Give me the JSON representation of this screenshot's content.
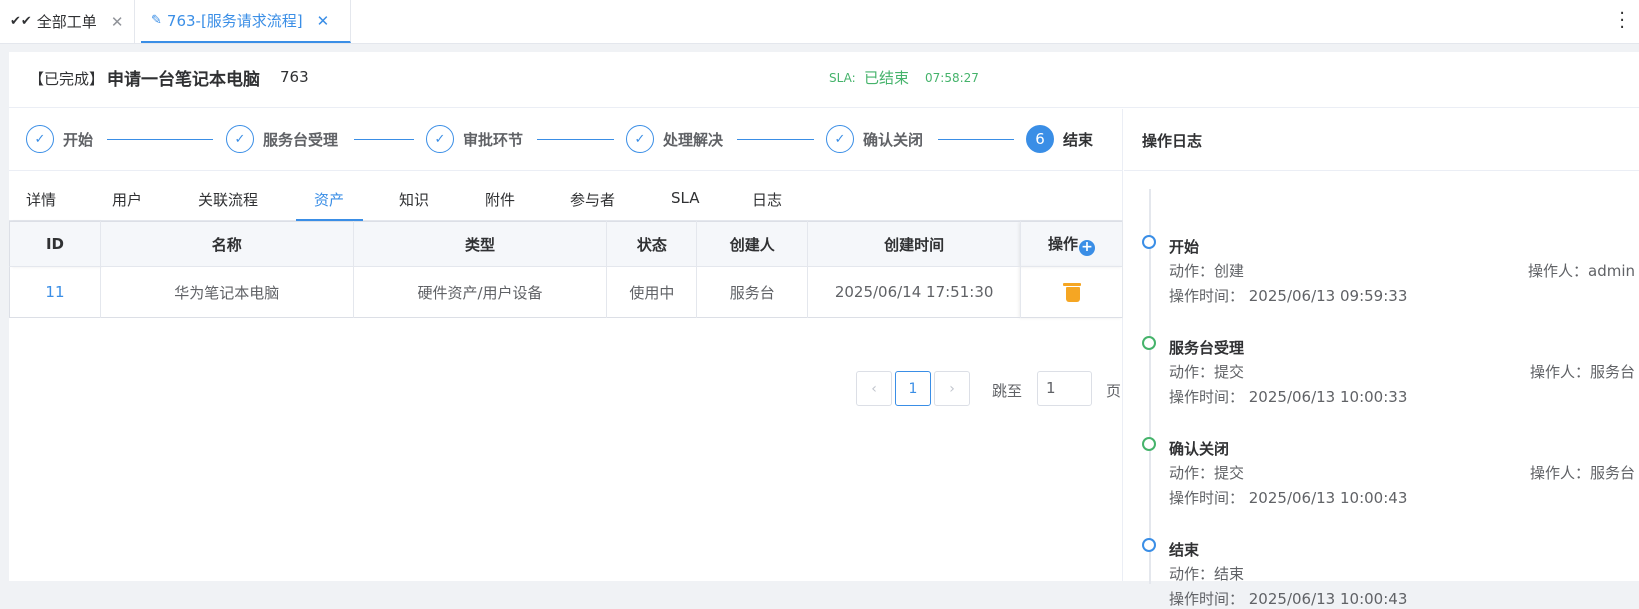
{
  "tabs": [
    {
      "icon": "✔✔",
      "label": "全部工单",
      "close": "✕"
    },
    {
      "icon": "✎",
      "label": "763-[服务请求流程]",
      "close": "✕"
    }
  ],
  "header": {
    "status": "【已完成】",
    "title": "申请一台笔记本电脑",
    "ticket_no": "763",
    "sla_label": "SLA:",
    "sla_status": "已结束",
    "sla_time": "07:58:27"
  },
  "steps": [
    {
      "mark": "✓",
      "label": "开始"
    },
    {
      "mark": "✓",
      "label": "服务台受理"
    },
    {
      "mark": "✓",
      "label": "审批环节"
    },
    {
      "mark": "✓",
      "label": "处理解决"
    },
    {
      "mark": "✓",
      "label": "确认关闭"
    },
    {
      "mark": "6",
      "label": "结束"
    }
  ],
  "detail_tabs": [
    "详情",
    "用户",
    "关联流程",
    "资产",
    "知识",
    "附件",
    "参与者",
    "SLA",
    "日志"
  ],
  "active_detail_tab": "资产",
  "table": {
    "columns": [
      "ID",
      "名称",
      "类型",
      "状态",
      "创建人",
      "创建时间",
      "操作"
    ],
    "add_icon": "+",
    "rows": [
      {
        "id": "11",
        "name": "华为笔记本电脑",
        "type": "硬件资产/用户设备",
        "status": "使用中",
        "creator": "服务台",
        "created": "2025/06/14 17:51:30"
      }
    ]
  },
  "pagination": {
    "prev": "‹",
    "page": "1",
    "next": "›",
    "jump_label": "跳至",
    "jump_value": "1",
    "page_suffix": "页"
  },
  "log": {
    "title": "操作日志",
    "entries": [
      {
        "name": "开始",
        "action": "动作：创建",
        "operator": "操作人：admin",
        "time": "操作时间：  2025/06/13 09:59:33"
      },
      {
        "name": "服务台受理",
        "action": "动作：提交",
        "operator": "操作人：服务台",
        "time": "操作时间：  2025/06/13 10:00:33"
      },
      {
        "name": "确认关闭",
        "action": "动作：提交",
        "operator": "操作人：服务台",
        "time": "操作时间：  2025/06/13 10:00:43"
      },
      {
        "name": "结束",
        "action": "动作：结束",
        "operator": "",
        "time": "操作时间：  2025/06/13 10:00:43"
      }
    ]
  },
  "colors": {
    "accent": "#3a8ee6",
    "success": "#45b36b",
    "warning": "#f5a623"
  }
}
